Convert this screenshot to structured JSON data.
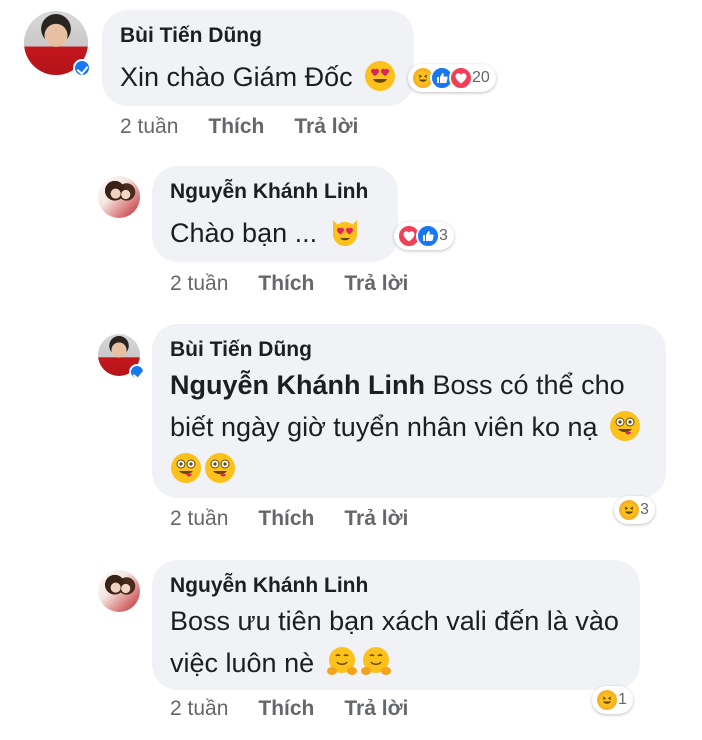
{
  "comments": [
    {
      "author": "Bùi Tiến Dũng",
      "text": "Xin chào Giám Đốc",
      "time": "2 tuần",
      "like_label": "Thích",
      "reply_label": "Trả lời",
      "reaction_count": "20",
      "reactions": [
        "haha",
        "like",
        "love"
      ],
      "avatar": "avatar-dung",
      "verified": true,
      "inline_emoji": [
        "heart-eyes-emoji"
      ]
    },
    {
      "author": "Nguyễn Khánh Linh",
      "text": "Chào bạn ...",
      "time": "2 tuần",
      "like_label": "Thích",
      "reply_label": "Trả lời",
      "reaction_count": "3",
      "reactions": [
        "love",
        "like"
      ],
      "avatar": "avatar-linh",
      "verified": false,
      "inline_emoji": [
        "heart-eyes-cat-emoji"
      ]
    },
    {
      "author": "Bùi Tiến Dũng",
      "mention": "Nguyễn Khánh Linh",
      "text": "Boss có thể cho biết ngày giờ tuyển nhân viên ko nạ",
      "time": "2 tuần",
      "like_label": "Thích",
      "reply_label": "Trả lời",
      "reaction_count": "3",
      "reactions": [
        "haha"
      ],
      "avatar": "avatar-dung",
      "verified": true,
      "inline_emoji": [
        "winking-tongue-emoji",
        "winking-tongue-emoji",
        "winking-tongue-emoji"
      ]
    },
    {
      "author": "Nguyễn Khánh Linh",
      "text": "Boss ưu tiên bạn xách vali đến là vào việc luôn nè",
      "time": "2 tuần",
      "like_label": "Thích",
      "reply_label": "Trả lời",
      "reaction_count": "1",
      "reactions": [
        "haha"
      ],
      "avatar": "avatar-linh",
      "verified": false,
      "inline_emoji": [
        "hugging-emoji",
        "hugging-emoji"
      ]
    }
  ],
  "colors": {
    "bubble": "#f0f2f5",
    "like_blue": "#1877f2",
    "love_red": "#f33e58",
    "haha_yellow": "#f7b125",
    "meta_gray": "#65676b"
  }
}
